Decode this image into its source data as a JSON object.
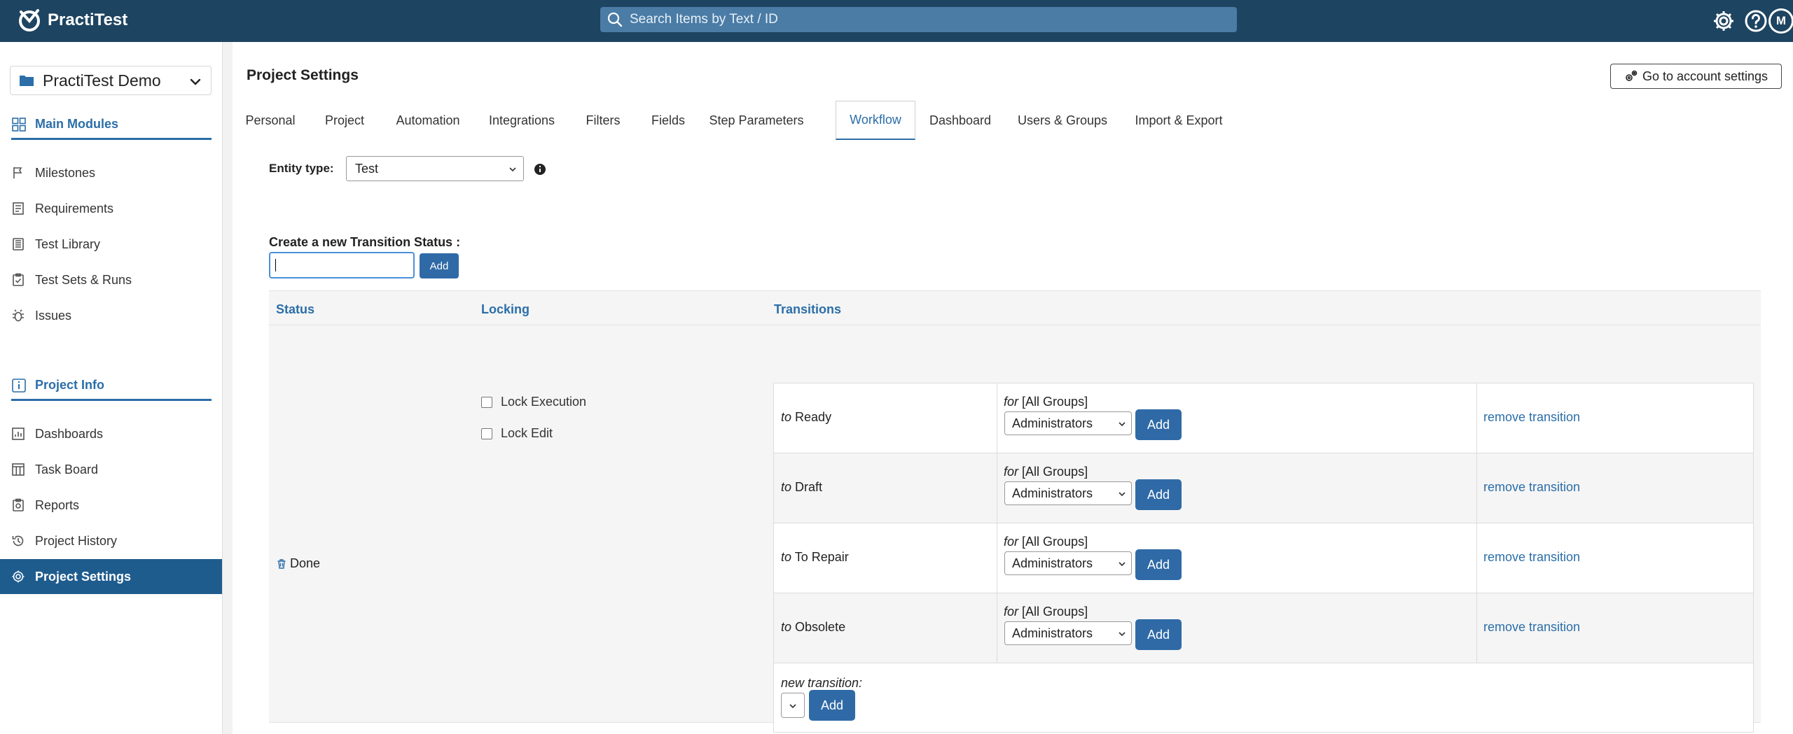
{
  "header": {
    "logo_text": "PractiTest",
    "search_placeholder": "Search Items by Text / ID",
    "avatar_initial": "M"
  },
  "sidebar": {
    "project_name": "PractiTest Demo",
    "main_modules_label": "Main Modules",
    "main_items": [
      "Milestones",
      "Requirements",
      "Test Library",
      "Test Sets & Runs",
      "Issues"
    ],
    "project_info_label": "Project Info",
    "info_items": [
      "Dashboards",
      "Task Board",
      "Reports",
      "Project History",
      "Project Settings"
    ],
    "active_item": "Project Settings"
  },
  "main": {
    "title": "Project Settings",
    "account_button": "Go to account settings",
    "tabs": [
      "Personal",
      "Project",
      "Automation",
      "Integrations",
      "Filters",
      "Fields",
      "Step Parameters",
      "Workflow",
      "Dashboard",
      "Users & Groups",
      "Import & Export"
    ],
    "active_tab": "Workflow",
    "entity_type_label": "Entity type:",
    "entity_type_value": "Test",
    "create_label": "Create a new Transition Status :",
    "create_add": "Add"
  },
  "table": {
    "headers": {
      "status": "Status",
      "locking": "Locking",
      "transitions": "Transitions"
    },
    "status": "Done",
    "locks": [
      "Lock Execution",
      "Lock Edit"
    ],
    "to_word": "to",
    "for_word": "for",
    "for_value": "[All Groups]",
    "transitions": [
      {
        "target": "Ready",
        "group": "Administrators",
        "add": "Add",
        "remove": "remove transition"
      },
      {
        "target": "Draft",
        "group": "Administrators",
        "add": "Add",
        "remove": "remove transition"
      },
      {
        "target": "To Repair",
        "group": "Administrators",
        "add": "Add",
        "remove": "remove transition"
      },
      {
        "target": "Obsolete",
        "group": "Administrators",
        "add": "Add",
        "remove": "remove transition"
      }
    ],
    "new_transition_label": "new transition:",
    "new_transition_add": "Add"
  }
}
